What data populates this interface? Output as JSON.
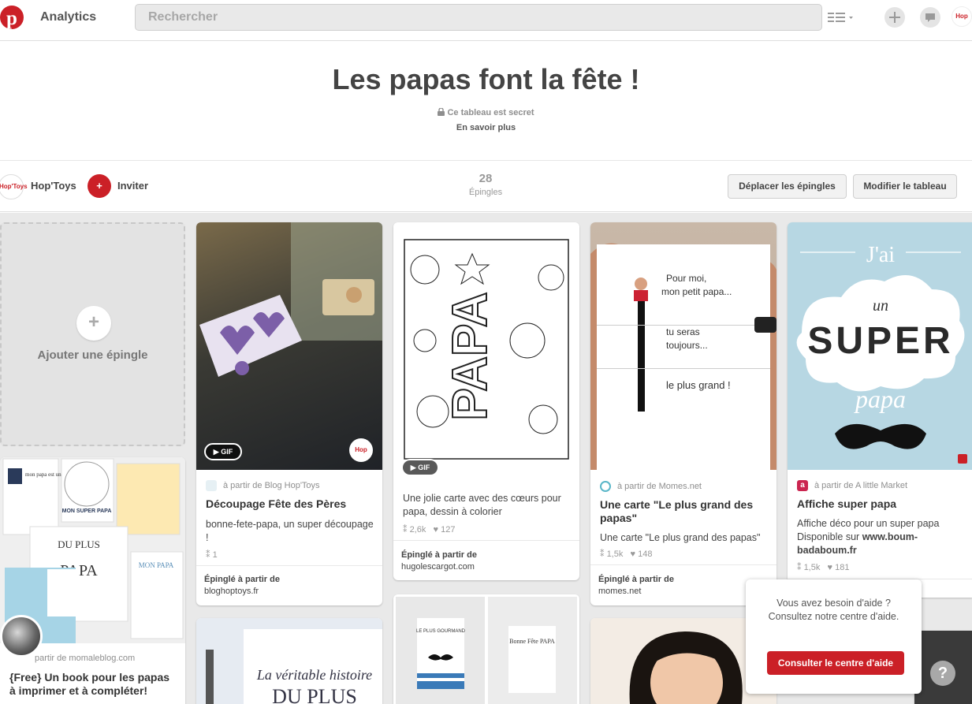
{
  "topbar": {
    "analytics_label": "Analytics",
    "search_placeholder": "Rechercher",
    "avatar_text": "Hop"
  },
  "board": {
    "title": "Les papas font la fête !",
    "secret_label": "Ce tableau est secret",
    "learn_more": "En savoir plus",
    "owner": "Hop'Toys",
    "owner_avatar": "Hop'Toys",
    "invite_icon": "+",
    "invite_label": "Inviter",
    "pin_count": "28",
    "pin_count_label": "Épingles",
    "move_pins_button": "Déplacer les épingles",
    "edit_board_button": "Modifier le tableau"
  },
  "add_pin": {
    "plus": "+",
    "label": "Ajouter une épingle"
  },
  "pins": [
    {
      "source": "à partir de Blog Hop'Toys",
      "title": "Découpage Fête des Pères",
      "description": "bonne-fete-papa, un super découpage !",
      "repins": "1",
      "pinned_from_label": "Épinglé à partir de",
      "pinned_from": "bloghoptoys.fr",
      "gif_label": "▶ GIF",
      "badge_label": "Hop"
    },
    {
      "description": "Une jolie carte avec des cœurs pour papa, dessin à colorier",
      "repins": "2,6k",
      "likes": "127",
      "pinned_from_label": "Épinglé à partir de",
      "pinned_from": "hugolescargot.com",
      "gif_label": "▶ GIF",
      "image_text": "PAPA"
    },
    {
      "source": "à partir de Momes.net",
      "title": "Une carte \"Le plus grand des papas\"",
      "description": "Une carte \"Le plus grand des papas\"",
      "repins": "1,5k",
      "likes": "148",
      "pinned_from_label": "Épinglé à partir de",
      "pinned_from": "momes.net",
      "image_lines": [
        "Pour moi,",
        "mon petit papa...",
        "tu seras",
        "toujours...",
        "le plus grand !"
      ]
    },
    {
      "source": "à partir de A little Market",
      "title": "Affiche super papa",
      "description_plain": "Affiche déco pour un super papa Disponible sur ",
      "description_bold": "www.boum-badaboum.fr",
      "repins": "1,5k",
      "likes": "181",
      "source_icon_letter": "a",
      "image_text": [
        "J'ai",
        "un",
        "SUPER",
        "papa"
      ]
    },
    {
      "source": "partir de momaleblog.com",
      "title": "{Free} Un book pour les papas à imprimer et à compléter!",
      "image_text": [
        "mon papa est un",
        "MON SUPER PAPA",
        "DU PLUS",
        "PAPA",
        "MON PAPA"
      ]
    },
    {
      "image_text": [
        "La véritable histoire",
        "DU PLUS"
      ]
    },
    {
      "image_text": [
        "LE PLUS GOURMAND",
        "Bonne Fête PAPA"
      ]
    }
  ],
  "help": {
    "text": "Vous avez besoin d'aide ? Consultez notre centre d'aide.",
    "button": "Consulter le centre d'aide",
    "question_icon": "?"
  },
  "colors": {
    "pinterest_red": "#cb2027",
    "grid_bg": "#e9e9e9"
  }
}
